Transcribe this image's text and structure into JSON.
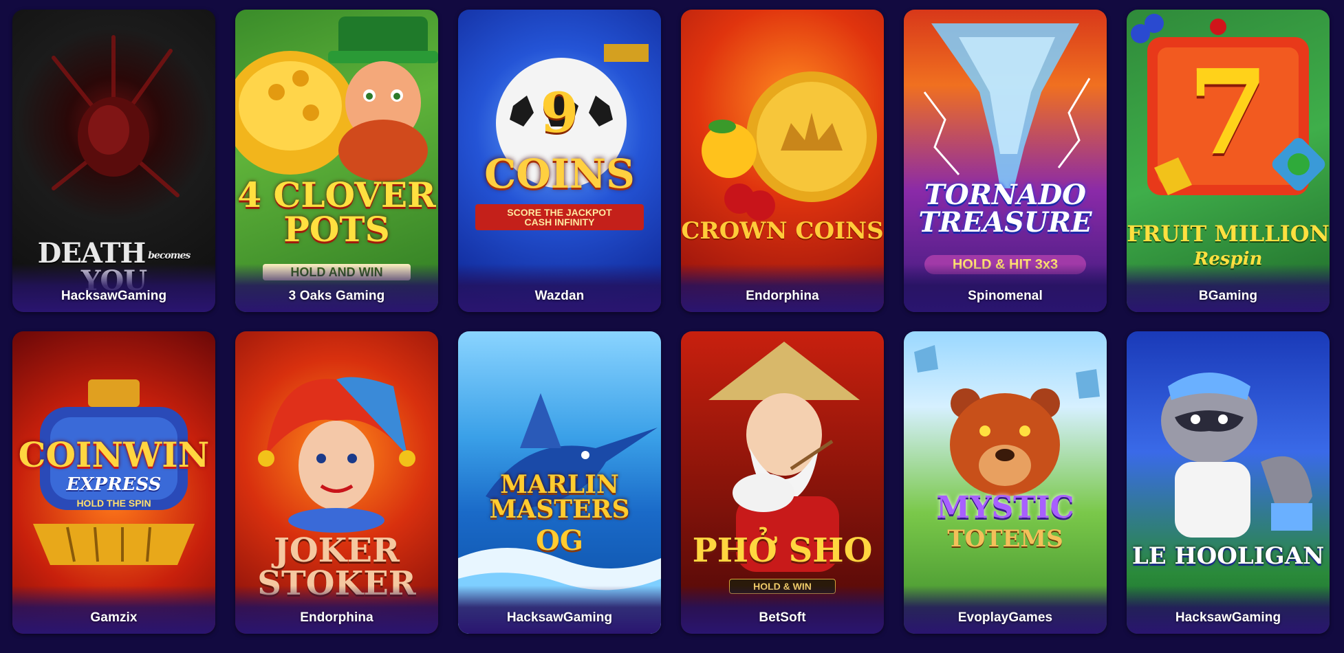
{
  "games": [
    {
      "title": "DEATH becomes YOU",
      "provider": "HacksawGaming",
      "theme": "dark"
    },
    {
      "title": "4 CLOVER POTS HOLD AND WIN",
      "provider": "3 Oaks Gaming",
      "theme": "clover"
    },
    {
      "title": "9 COINS SCORE THE JACKPOT CASH INFINITY",
      "provider": "Wazdan",
      "theme": "blue"
    },
    {
      "title": "CROWN COINS",
      "provider": "Endorphina",
      "theme": "crown"
    },
    {
      "title": "TORNADO TREASURE HOLD & HIT 3x3",
      "provider": "Spinomenal",
      "theme": "tornado"
    },
    {
      "title": "FRUIT MILLION Respin",
      "provider": "BGaming",
      "theme": "fruit"
    },
    {
      "title": "COIN WIN EXPRESS HOLD THE SPIN",
      "provider": "Gamzix",
      "theme": "coinwin"
    },
    {
      "title": "JOKER STOKER",
      "provider": "Endorphina",
      "theme": "joker"
    },
    {
      "title": "MARLIN MASTERS OG",
      "provider": "HacksawGaming",
      "theme": "marlin"
    },
    {
      "title": "PHỞ SHO HOLD & WIN",
      "provider": "BetSoft",
      "theme": "pho"
    },
    {
      "title": "MYSTIC TOTEMS",
      "provider": "EvoplayGames",
      "theme": "mystic"
    },
    {
      "title": "LE HOOLIGAN",
      "provider": "HacksawGaming",
      "theme": "hooligan"
    }
  ]
}
